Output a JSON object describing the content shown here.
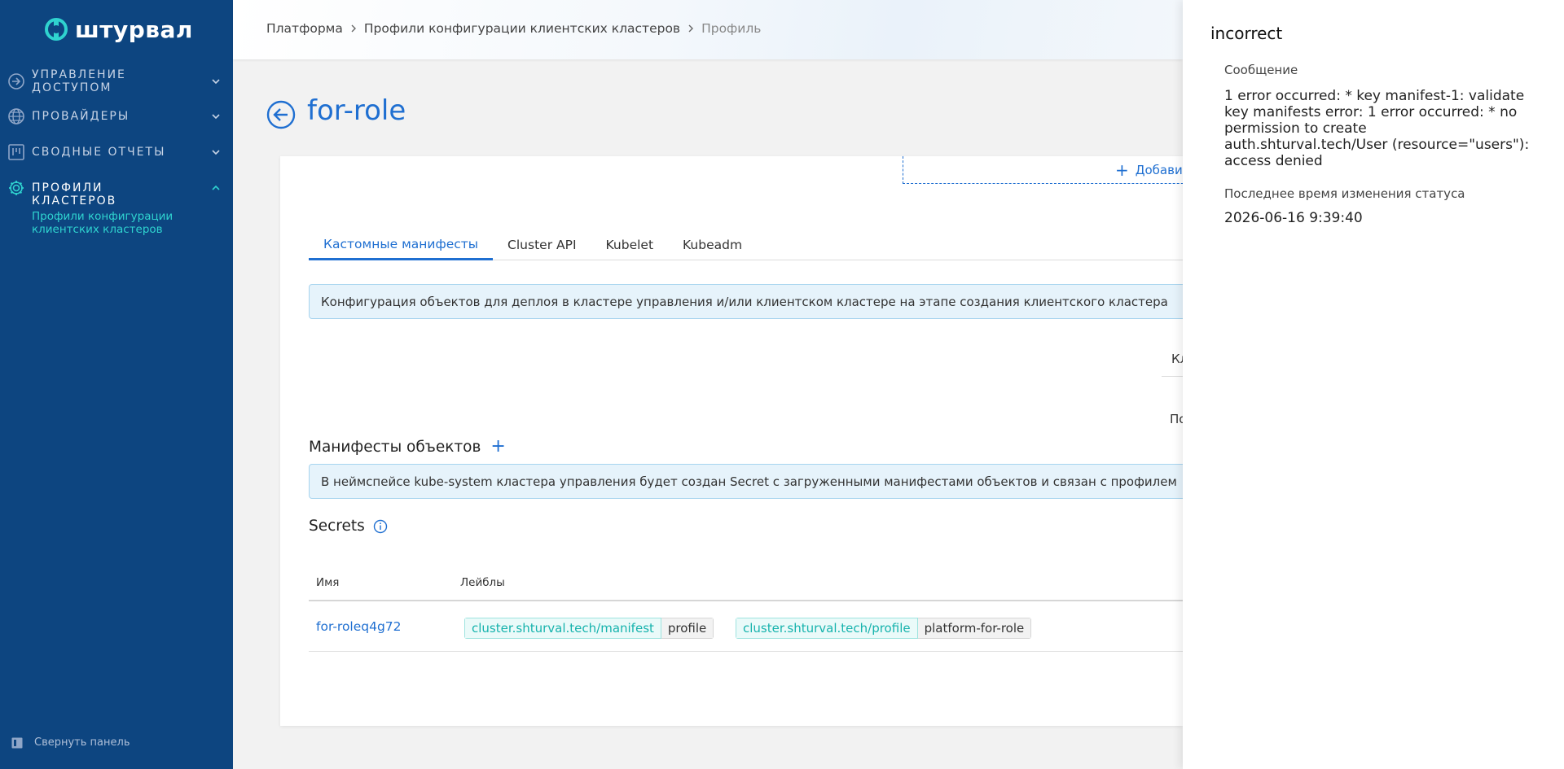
{
  "brand": {
    "name": "штурвал"
  },
  "sidebar": {
    "items": [
      {
        "label": "Управление доступом",
        "icon": "login-arrow-icon"
      },
      {
        "label": "Провайдеры",
        "icon": "globe-icon"
      },
      {
        "label": "Сводные отчеты",
        "icon": "kanban-board-icon"
      },
      {
        "label": "Профили кластеров",
        "icon": "gear-icon"
      }
    ],
    "active_sub_item": "Профили конфигурации клиентских кластеров",
    "collapse_label": "Свернуть панель"
  },
  "breadcrumbs": [
    "Платформа",
    "Профили конфигурации клиентских кластеров",
    "Профиль"
  ],
  "page": {
    "title": "for-role",
    "add_label": "Добавит",
    "tabs": [
      "Кастомные манифесты",
      "Cluster API",
      "Kubelet",
      "Kubeadm"
    ],
    "active_tab": "Кастомные манифесты",
    "info_config": "Конфигурация объектов для деплоя в кластере управления и/или клиентском кластере на этапе создания клиентского кластера",
    "right_fragment_1": "Кл",
    "right_fragment_2": "По",
    "manifests_title": "Манифесты объектов",
    "info_manifests": "В неймспейсе kube-system кластера управления будет создан Secret с загруженными манифестами объектов и связан с профилем",
    "secrets_title": "Secrets",
    "table": {
      "columns": [
        "Имя",
        "Лейблы"
      ],
      "rows": [
        {
          "name": "for-roleq4g72",
          "labels": [
            {
              "key": "cluster.shturval.tech/manifest",
              "value": "profile"
            },
            {
              "key": "cluster.shturval.tech/profile",
              "value": "platform-for-role"
            }
          ]
        }
      ]
    }
  },
  "panel": {
    "title": "incorrect",
    "message_label": "Сообщение",
    "message": "1 error occurred: * key manifest-1: validate key manifests error: 1 error occurred: * no permission to create auth.shturval.tech/User (resource=\"users\"): access denied",
    "status_time_label": "Последнее время изменения статуса",
    "status_time": "2026-06-16 9:39:40"
  },
  "colors": {
    "sidebar_bg": "#0d4580",
    "accent": "#1f6fd1",
    "teal": "#2fd3cf",
    "info_bg": "#e6f3fb"
  }
}
